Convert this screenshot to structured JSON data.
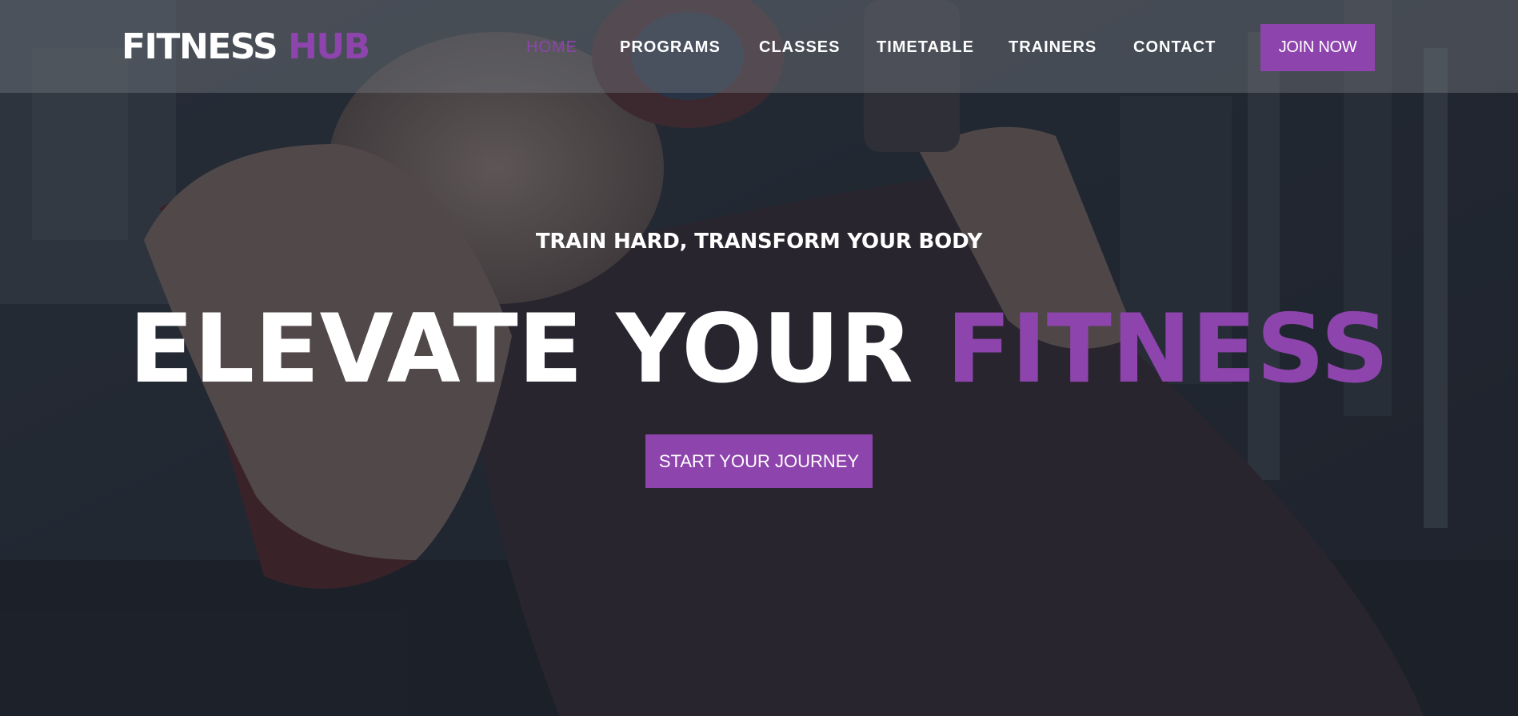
{
  "brand": {
    "name_primary": "FITNESS",
    "name_accent": "HUB"
  },
  "nav": {
    "items": [
      {
        "label": "HOME",
        "active": true
      },
      {
        "label": "PROGRAMS",
        "active": false
      },
      {
        "label": "CLASSES",
        "active": false
      },
      {
        "label": "TIMETABLE",
        "active": false
      },
      {
        "label": "TRAINERS",
        "active": false
      },
      {
        "label": "CONTACT",
        "active": false
      }
    ],
    "join_label": "JOIN NOW"
  },
  "hero": {
    "tagline": "TRAIN HARD, TRANSFORM YOUR BODY",
    "headline_primary": "ELEVATE YOUR",
    "headline_accent": "FITNESS",
    "cta_label": "START YOUR JOURNEY",
    "background_image": "man-lifting-dumbbells-on-bench-photo"
  },
  "colors": {
    "accent": "#8e44ad",
    "text": "#ffffff",
    "overlay": "#1b1f29"
  }
}
